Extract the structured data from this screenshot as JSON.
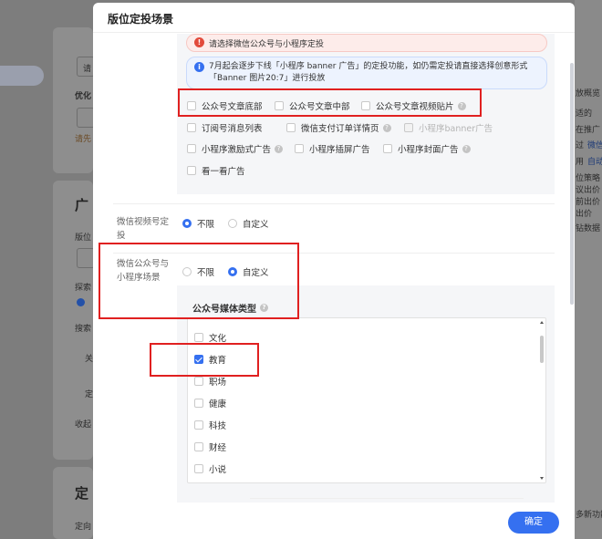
{
  "background": {
    "left_texts": [
      "请",
      "优化",
      "请先",
      "广",
      "版位",
      "探索",
      "搜索",
      "关",
      "定",
      "收起",
      "定",
      "定向"
    ],
    "right_texts": [
      "放概览",
      "适的",
      "在推广",
      "过",
      "微信",
      "用",
      "自动",
      "位策略",
      "议出价",
      "前出价",
      "出价",
      "钻数据",
      "多新功能"
    ]
  },
  "modal": {
    "title": "版位定投场景",
    "error_notice": "请选择微信公众号与小程序定投",
    "info_notice": "7月起会逐步下线「小程序 banner 广告」的定投功能，如仍需定投请直接选择创意形式「Banner 图片20:7」进行投放",
    "placements": [
      {
        "label": "公众号文章底部",
        "checked": false,
        "help": false
      },
      {
        "label": "公众号文章中部",
        "checked": false,
        "help": false
      },
      {
        "label": "公众号文章视频贴片",
        "checked": false,
        "help": true
      },
      {
        "label": "订阅号消息列表",
        "checked": false,
        "help": false
      },
      {
        "label": "微信支付订单详情页",
        "checked": false,
        "help": true
      },
      {
        "label": "小程序banner广告",
        "checked": false,
        "help": false,
        "disabled": true
      },
      {
        "label": "小程序激励式广告",
        "checked": false,
        "help": true
      },
      {
        "label": "小程序插屏广告",
        "checked": false,
        "help": false
      },
      {
        "label": "小程序封面广告",
        "checked": false,
        "help": true
      },
      {
        "label": "看一看广告",
        "checked": false,
        "help": false
      }
    ],
    "video_row": {
      "label": "微信视频号定投",
      "options": [
        "不限",
        "自定义"
      ],
      "selected": "不限"
    },
    "mp_row": {
      "label": "微信公众号与小程序场景",
      "options": [
        "不限",
        "自定义"
      ],
      "selected": "自定义"
    },
    "media_type": {
      "title": "公众号媒体类型",
      "items": [
        {
          "label": "文化",
          "checked": false
        },
        {
          "label": "教育",
          "checked": true
        },
        {
          "label": "职场",
          "checked": false
        },
        {
          "label": "健康",
          "checked": false
        },
        {
          "label": "科技",
          "checked": false
        },
        {
          "label": "财经",
          "checked": false
        },
        {
          "label": "小说",
          "checked": false
        }
      ]
    },
    "ok_label": "确定"
  },
  "colors": {
    "accent": "#3570f0",
    "annotation": "#e02020",
    "error_bg": "#fdecea",
    "info_bg": "#edf3fe"
  }
}
